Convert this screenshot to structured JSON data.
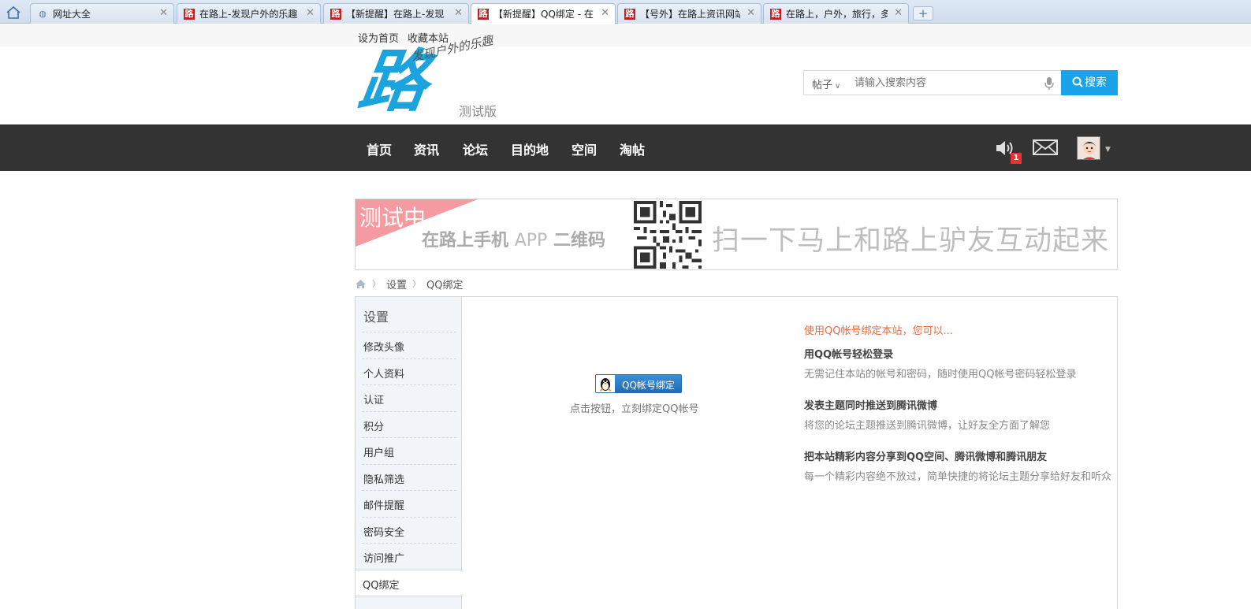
{
  "browser": {
    "tabs": [
      {
        "title": "网址大全",
        "favicon": "globe-icon"
      },
      {
        "title": "在路上-发现户外的乐趣",
        "favicon": "lu-logo-icon"
      },
      {
        "title": "【新提醒】在路上-发现",
        "favicon": "lu-logo-icon"
      },
      {
        "title": "【新提醒】QQ绑定 - 在",
        "favicon": "lu-logo-icon"
      },
      {
        "title": "【号外】在路上资讯网站",
        "favicon": "lu-logo-icon"
      },
      {
        "title": "在路上，户外，旅行，多",
        "favicon": "lu-logo-icon"
      }
    ],
    "new_tab": "+"
  },
  "toplinks": {
    "set_home": "设为首页",
    "bookmark": "收藏本站"
  },
  "logo": {
    "char": "路",
    "slogan": "发现户外的乐趣",
    "beta": "测试版"
  },
  "search": {
    "category": "帖子",
    "placeholder": "请输入搜索内容",
    "button": "搜索"
  },
  "nav": {
    "items": [
      "首页",
      "资讯",
      "论坛",
      "目的地",
      "空间",
      "淘帖"
    ],
    "notify_count": "1"
  },
  "banner": {
    "ribbon": "测试中",
    "app_bold": "在路上手机",
    "app_thin": "APP",
    "app_bold2": "二维码",
    "slogan": "扫一下马上和路上驴友互动起来"
  },
  "breadcrumb": {
    "settings": "设置",
    "current": "QQ绑定"
  },
  "sidebar": {
    "title": "设置",
    "items": [
      "修改头像",
      "个人资料",
      "认证",
      "积分",
      "用户组",
      "隐私筛选",
      "邮件提醒",
      "密码安全",
      "访问推广"
    ],
    "current": "QQ绑定"
  },
  "main": {
    "bind_button": "QQ帐号绑定",
    "hint": "点击按钮，立刻绑定QQ帐号",
    "lead": "使用QQ帐号绑定本站，您可以...",
    "features": [
      {
        "title": "用QQ帐号轻松登录",
        "desc": "无需记住本站的帐号和密码，随时使用QQ帐号密码轻松登录"
      },
      {
        "title": "发表主题同时推送到腾讯微博",
        "desc": "将您的论坛主题推送到腾讯微博，让好友全方面了解您"
      },
      {
        "title": "把本站精彩内容分享到QQ空间、腾讯微博和腾讯朋友",
        "desc": "每一个精彩内容绝不放过，简单快捷的将论坛主题分享给好友和听众"
      }
    ]
  },
  "colors": {
    "nav_bg": "#333333",
    "accent": "#1aa3e8",
    "lead_orange": "#e66a3c",
    "badge_red": "#e53333"
  }
}
